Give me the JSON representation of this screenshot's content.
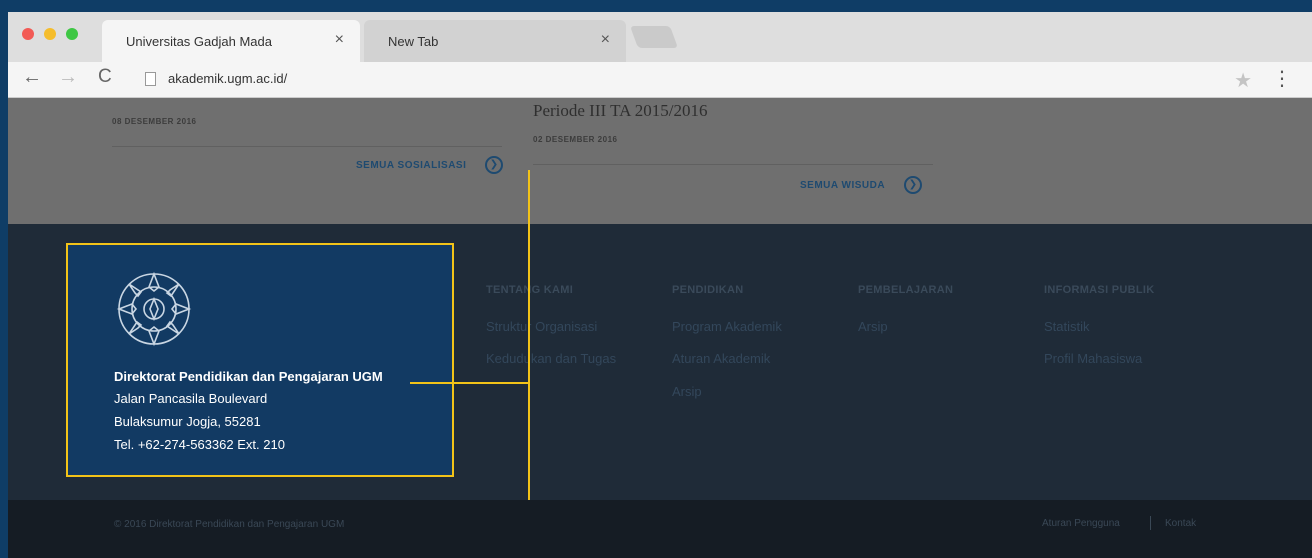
{
  "browser": {
    "tabs": [
      {
        "title": "Universitas Gadjah Mada",
        "close": "×"
      },
      {
        "title": "New Tab",
        "close": "×"
      }
    ],
    "url": "akademik.ugm.ac.id/",
    "icons": {
      "back": "←",
      "forward": "→",
      "reload": "C",
      "star": "★",
      "menu": "⋮"
    }
  },
  "content": {
    "wisuda_title": "Periode III TA 2015/2016",
    "date_1": "08 DESEMBER 2016",
    "date_2": "02 DESEMBER 2016",
    "link_sosialisasi": "SEMUA SOSIALISASI",
    "link_wisuda": "SEMUA WISUDA"
  },
  "footer": {
    "info": {
      "name": "Direktorat Pendidikan dan Pengajaran UGM",
      "address_1": "Jalan Pancasila Boulevard",
      "address_2": "Bulaksumur Jogja, 55281",
      "phone": "Tel. +62-274-563362 Ext. 210"
    },
    "columns": [
      {
        "heading": "TENTANG KAMI",
        "links": [
          "Struktur Organisasi",
          "Kedudukan dan Tugas"
        ]
      },
      {
        "heading": "PENDIDIKAN",
        "links": [
          "Program Akademik",
          "Aturan Akademik",
          "Arsip"
        ]
      },
      {
        "heading": "PEMBELAJARAN",
        "links": [
          "Arsip"
        ]
      },
      {
        "heading": "INFORMASI PUBLIK",
        "links": [
          "Statistik",
          "Profil Mahasiswa"
        ]
      }
    ],
    "copyright": "© 2016 Direktorat Pendidikan dan Pengajaran UGM",
    "bottom_links": [
      "Aturan Pengguna",
      "Kontak"
    ]
  },
  "colors": {
    "highlight": "#f2c318",
    "footer_bg": "#1f2b38",
    "info_box_bg": "#123a63"
  }
}
